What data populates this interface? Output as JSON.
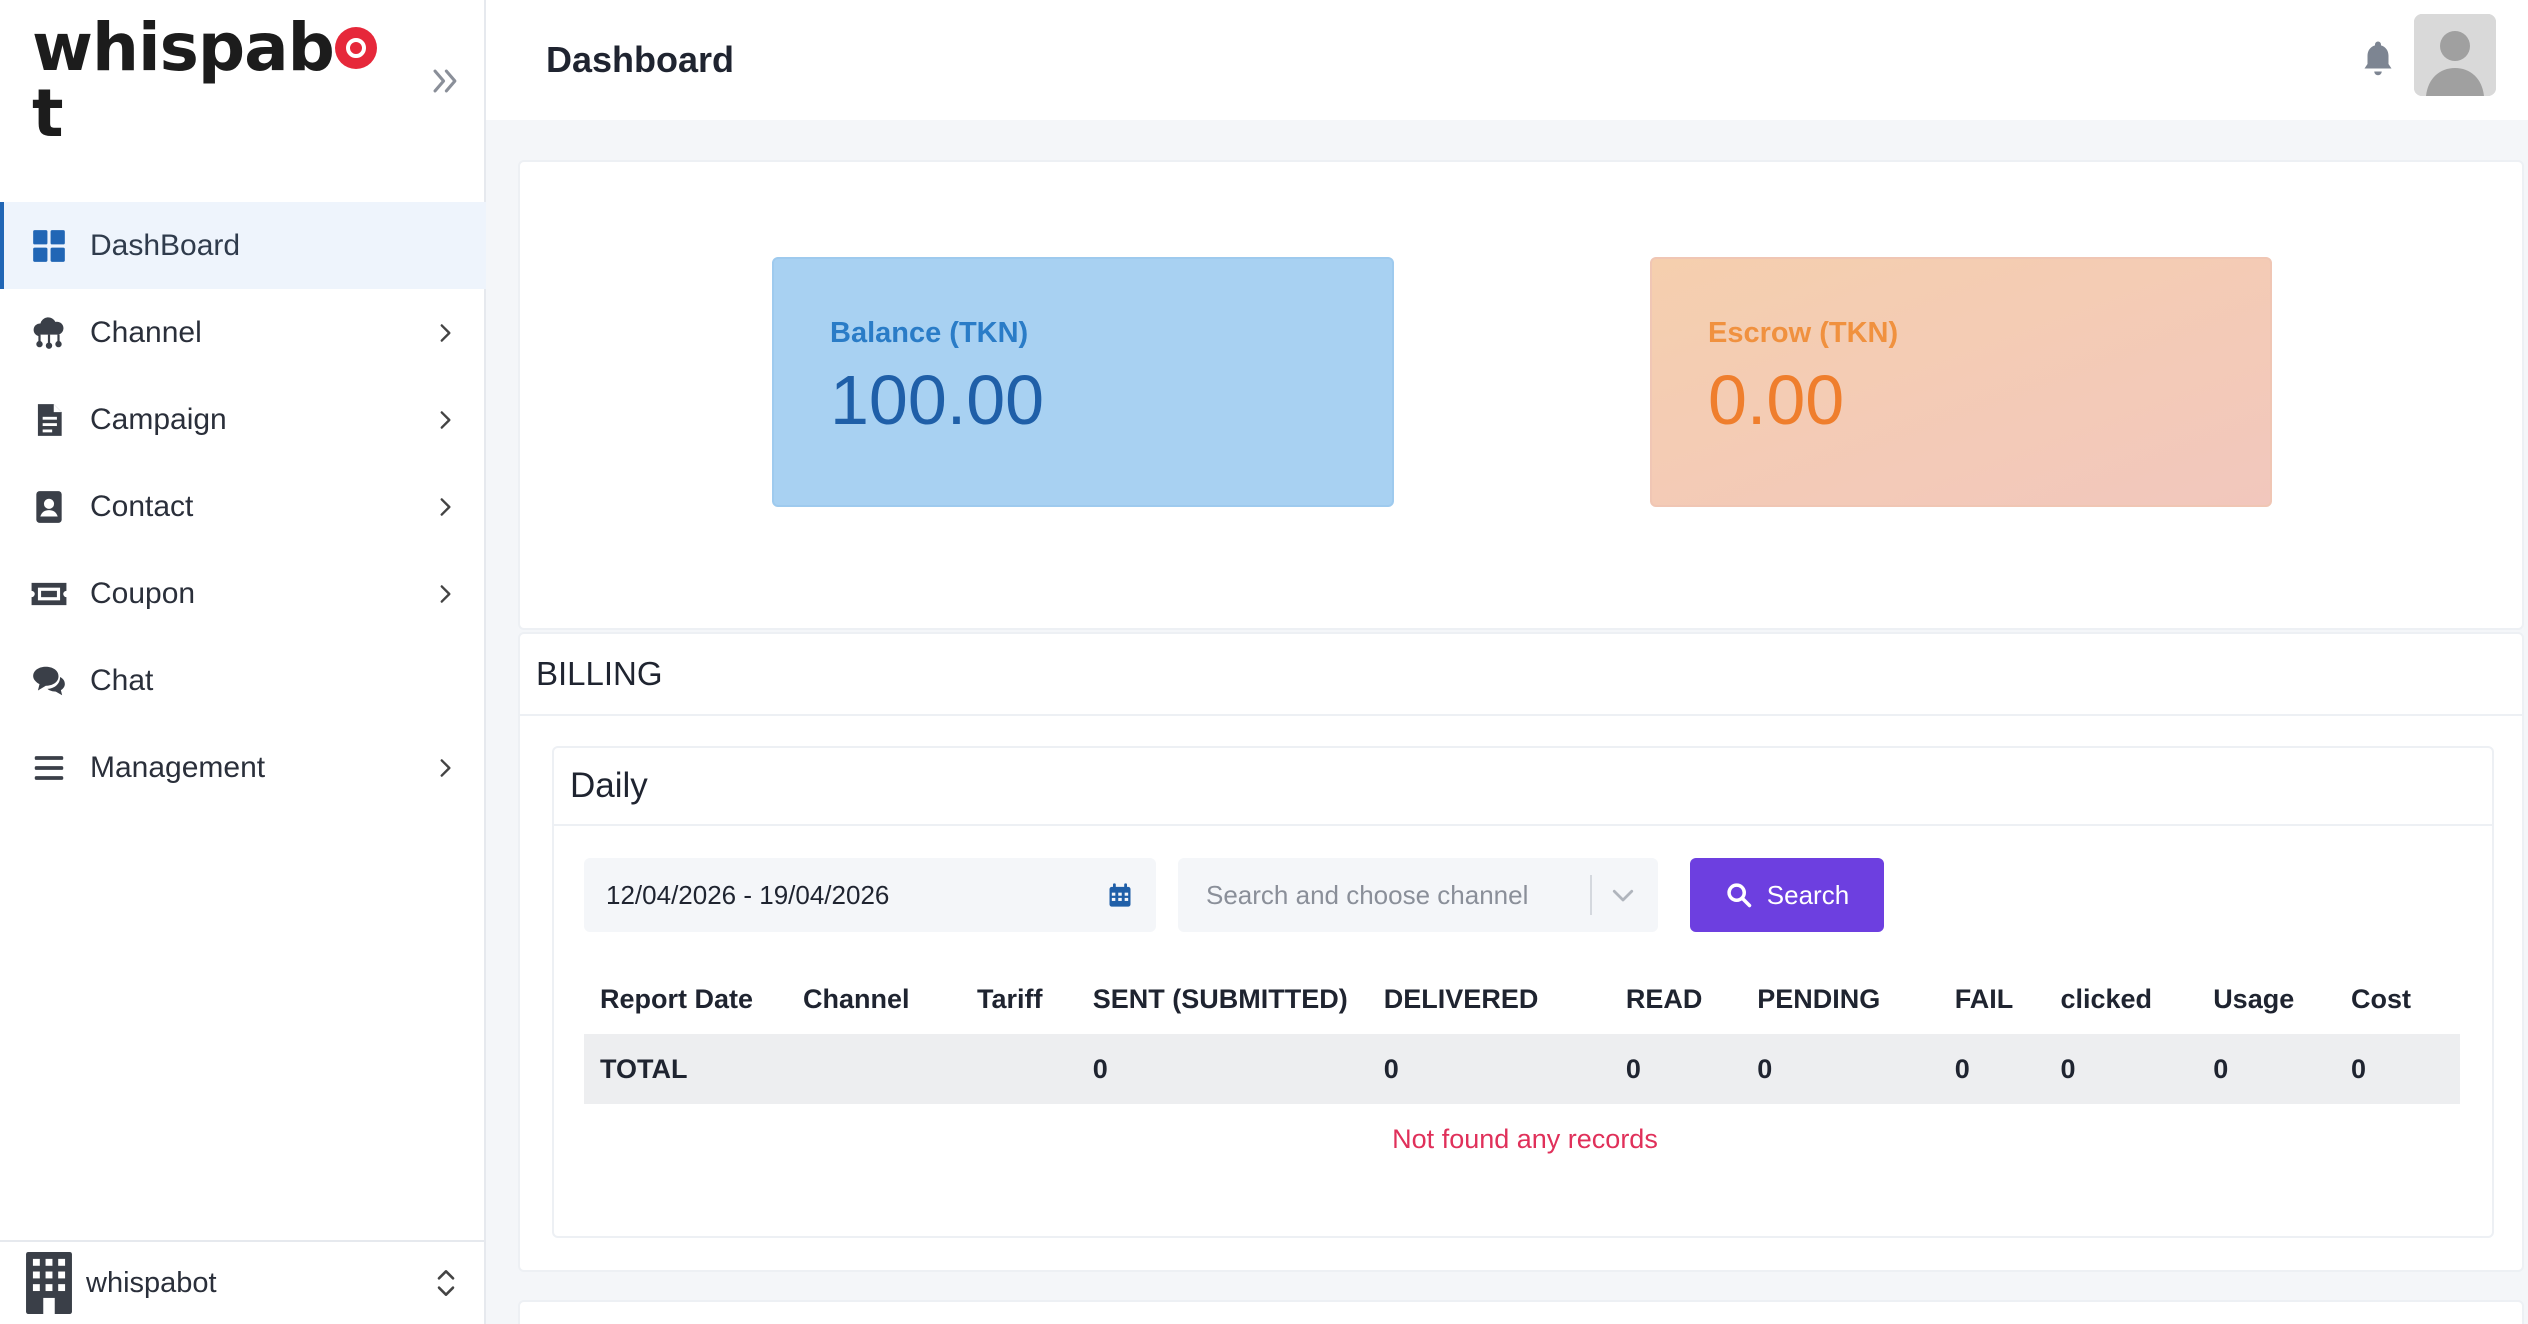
{
  "brand": {
    "logo_prefix": "whispab",
    "logo_suffix": "t"
  },
  "header": {
    "title": "Dashboard"
  },
  "sidebar": {
    "items": [
      {
        "label": "DashBoard",
        "icon": "dashboard-grid-icon",
        "active": true,
        "expandable": false
      },
      {
        "label": "Channel",
        "icon": "cloud-network-icon",
        "active": false,
        "expandable": true
      },
      {
        "label": "Campaign",
        "icon": "document-list-icon",
        "active": false,
        "expandable": true
      },
      {
        "label": "Contact",
        "icon": "contact-book-icon",
        "active": false,
        "expandable": true
      },
      {
        "label": "Coupon",
        "icon": "ticket-icon",
        "active": false,
        "expandable": true
      },
      {
        "label": "Chat",
        "icon": "chat-bubbles-icon",
        "active": false,
        "expandable": false
      },
      {
        "label": "Management",
        "icon": "menu-lines-icon",
        "active": false,
        "expandable": true
      }
    ],
    "org": {
      "label": "whispabot"
    }
  },
  "stats": {
    "balance": {
      "label": "Balance (TKN)",
      "value": "100.00"
    },
    "escrow": {
      "label": "Escrow (TKN)",
      "value": "0.00"
    }
  },
  "billing": {
    "title": "BILLING",
    "daily": {
      "title": "Daily",
      "date_range": "12/04/2026 - 19/04/2026",
      "channel_placeholder": "Search and choose channel",
      "search_label": "Search",
      "columns": [
        "Report Date",
        "Channel",
        "Tariff",
        "SENT (SUBMITTED)",
        "DELIVERED",
        "READ",
        "PENDING",
        "FAIL",
        "clicked",
        "Usage",
        "Cost"
      ],
      "total_row": [
        "TOTAL",
        "",
        "",
        "0",
        "0",
        "0",
        "0",
        "0",
        "0",
        "0",
        "0"
      ],
      "empty_message": "Not found any records"
    }
  },
  "colors": {
    "accent": "#6d3fe0",
    "active_nav": "#2166b5",
    "balance_card": "#a8d1f2",
    "escrow_card": "#f5cfae",
    "empty_message": "#e0305a"
  }
}
